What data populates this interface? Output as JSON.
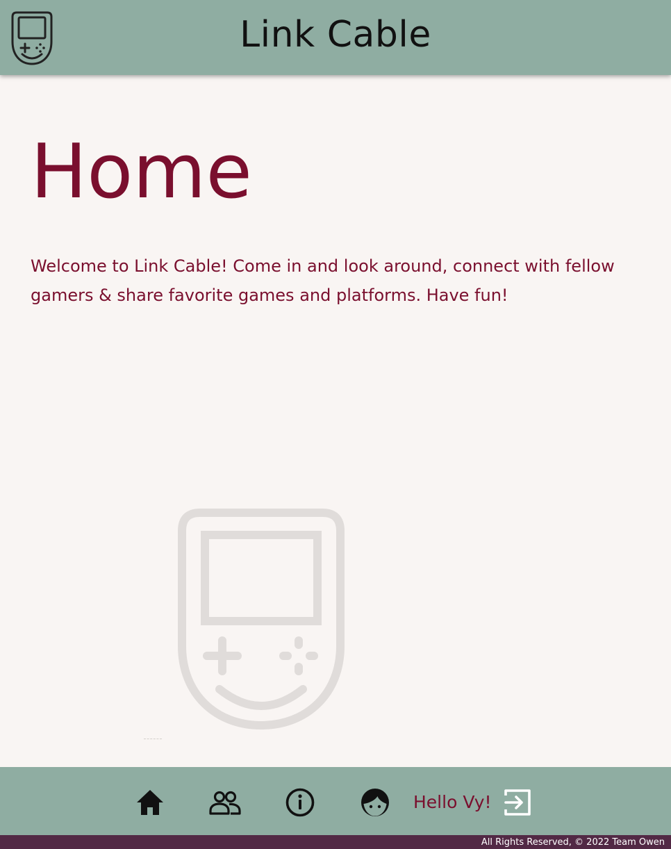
{
  "header": {
    "app_title": "Link Cable",
    "logo_icon": "handheld-console-icon"
  },
  "main": {
    "page_title": "Home",
    "welcome_text": "Welcome to Link Cable! Come in and look around, connect with fellow gamers & share favorite games and platforms. Have fun!",
    "watermark_icon": "handheld-console-icon"
  },
  "nav": {
    "items": [
      {
        "icon": "home-icon"
      },
      {
        "icon": "users-icon"
      },
      {
        "icon": "info-icon"
      },
      {
        "icon": "profile-face-icon"
      }
    ],
    "greeting": "Hello Vy!",
    "logout_icon": "logout-icon"
  },
  "footer": {
    "copyright": "All Rights Reserved, © 2022 Team Owen"
  },
  "colors": {
    "header_bg": "#8fada2",
    "page_bg": "#f9f5f3",
    "accent_text": "#7a0f2e",
    "footer_bg": "#522945",
    "watermark": "#e0dcda"
  }
}
